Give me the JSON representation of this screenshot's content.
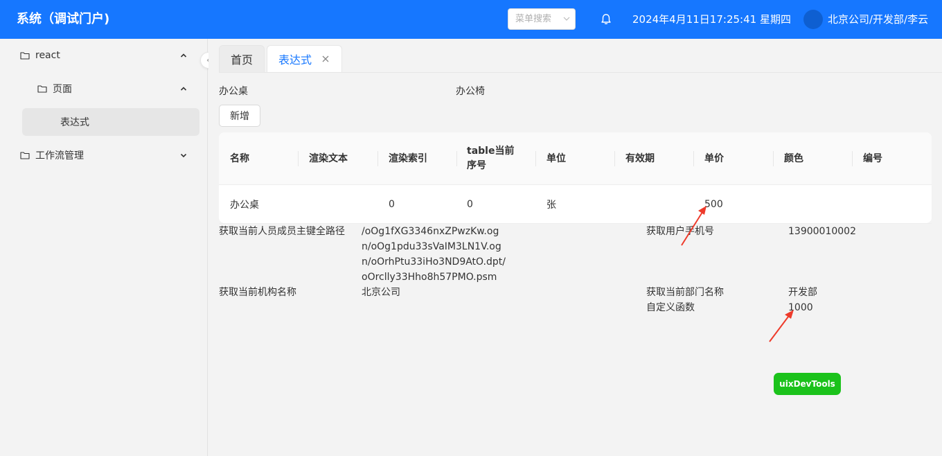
{
  "header": {
    "title": "系统（调试门户)",
    "menu_search_placeholder": "菜单搜索",
    "datetime": "2024年4月11日17:25:41 星期四",
    "user": "北京公司/开发部/李云",
    "bg_color": "#1677ff"
  },
  "sidebar": {
    "items": [
      {
        "label": "react",
        "icon": "folder-icon",
        "expanded": true
      },
      {
        "label": "页面",
        "icon": "folder-icon",
        "expanded": true
      },
      {
        "label": "表达式",
        "active": true
      },
      {
        "label": "工作流管理",
        "icon": "folder-icon",
        "expanded": false
      }
    ]
  },
  "tabs": [
    {
      "label": "首页",
      "active": false
    },
    {
      "label": "表达式",
      "active": true
    }
  ],
  "form": {
    "label_desk": "办公桌",
    "label_chair": "办公椅",
    "add_button": "新增"
  },
  "table": {
    "columns": [
      "名称",
      "渲染文本",
      "渲染索引",
      "table当前序号",
      "单位",
      "有效期",
      "单价",
      "颜色",
      "编号"
    ],
    "rows": [
      [
        "办公桌",
        "",
        "0",
        "0",
        "张",
        "",
        "500",
        "",
        ""
      ]
    ]
  },
  "info": {
    "person_path_label": "获取当前人员成员主键全路径",
    "person_path_value": "/oOg1fXG3346nxZPwzKw.ogn/oOg1pdu33sVaIM3LN1V.ogn/oOrhPtu33iHo3ND9AtO.dpt/oOrclly33Hho8h57PMO.psm",
    "phone_label": "获取用户手机号",
    "phone_value": "13900010002",
    "org_label": "获取当前机构名称",
    "org_value": "北京公司",
    "dept_label": "获取当前部门名称",
    "dept_value": "开发部",
    "custom_label": "自定义函数",
    "custom_value": "1000"
  },
  "devtools_label": "uixDevTools",
  "colors": {
    "accent": "#1677ff",
    "devtools_green": "#1bc21b",
    "annotation_red": "#ee3b2b"
  }
}
